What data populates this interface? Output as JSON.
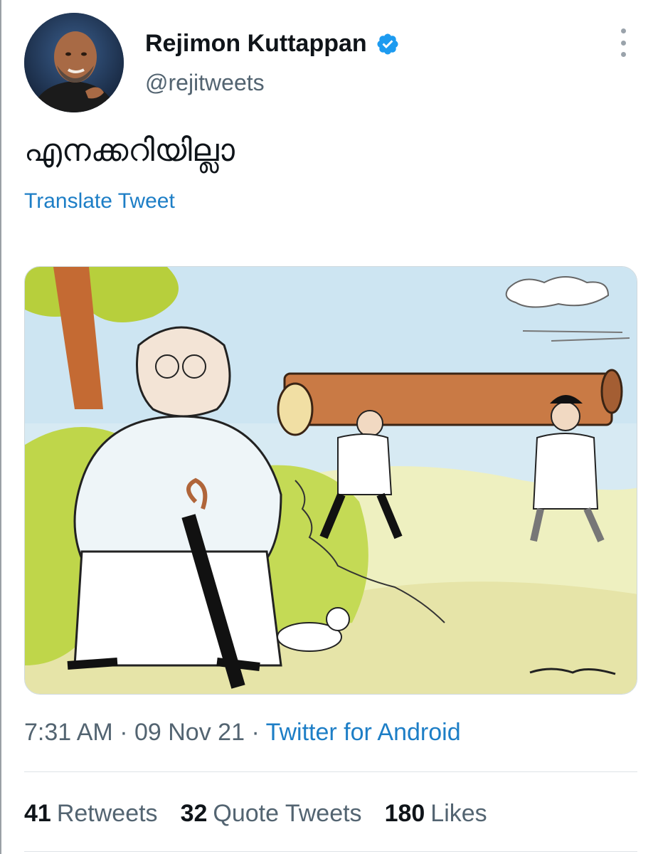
{
  "tweet": {
    "author_name": "Rejimon Kuttappan",
    "author_handle": "@rejitweets",
    "text": "എനക്കറിയില്ലാ",
    "translate_label": "Translate Tweet",
    "time": "7:31 AM",
    "separator": "·",
    "date": "09 Nov 21",
    "source": "Twitter for Android"
  },
  "stats": {
    "retweets_count": "41",
    "retweets_label": "Retweets",
    "quotes_count": "32",
    "quotes_label": "Quote Tweets",
    "likes_count": "180",
    "likes_label": "Likes"
  },
  "icons": {
    "verified": "verified-badge-icon",
    "more": "more-options-icon"
  },
  "colors": {
    "link": "#1d7ec6",
    "verified": "#1d9bf0",
    "secondary_text": "#536471"
  }
}
